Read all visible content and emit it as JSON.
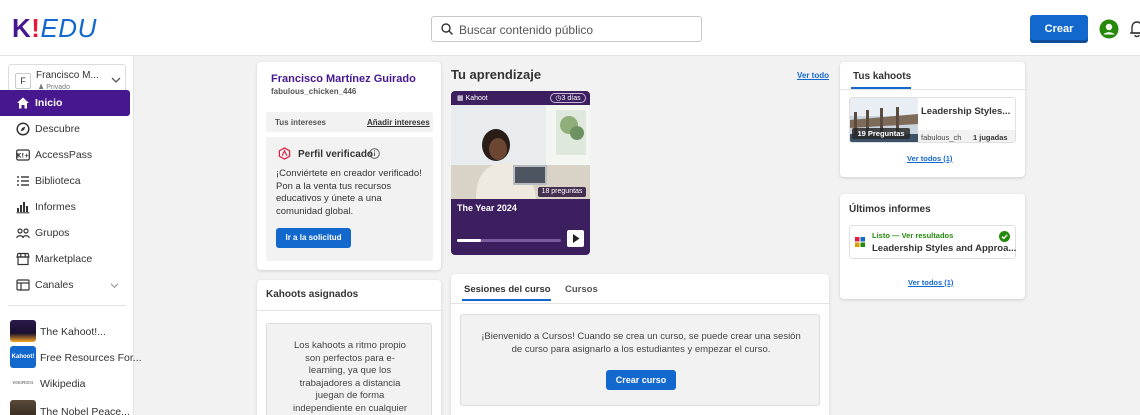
{
  "header": {
    "logo_k": "K",
    "logo_bang": "!",
    "logo_edu": "EDU",
    "search_placeholder": "Buscar contenido público",
    "create_label": "Crear"
  },
  "sidebar": {
    "account": {
      "initial": "F",
      "name": "Francisco M...",
      "privacy": "Privado"
    },
    "items": [
      {
        "label": "Inicio",
        "icon": "home-icon",
        "active": true
      },
      {
        "label": "Descubre",
        "icon": "compass-icon"
      },
      {
        "label": "AccessPass",
        "icon": "accesspass-icon"
      },
      {
        "label": "Biblioteca",
        "icon": "list-icon"
      },
      {
        "label": "Informes",
        "icon": "chart-icon"
      },
      {
        "label": "Grupos",
        "icon": "group-icon"
      },
      {
        "label": "Marketplace",
        "icon": "store-icon"
      },
      {
        "label": "Canales",
        "icon": "channel-icon"
      }
    ],
    "channels": [
      {
        "label": "The Kahoot!...",
        "thumb": ""
      },
      {
        "label": "Free Resources For...",
        "thumb": "Kahoot!"
      },
      {
        "label": "Wikipedia",
        "thumb": "WIKIPEDIA"
      },
      {
        "label": "The Nobel Peace...",
        "thumb": ""
      }
    ]
  },
  "profile": {
    "name": "Francisco Martínez Guirado",
    "username": "fabulous_chicken_446",
    "interests_label": "Tus intereses",
    "add_interests": "Añadir intereses",
    "verified_title": "Perfil verificado",
    "verified_desc": "¡Conviértete en creador verificado! Pon a la venta tus recursos educativos y únete a una comunidad global.",
    "apply_button": "Ir a la solicitud"
  },
  "assigned": {
    "title": "Kahoots asignados",
    "text": "Los kahoots a ritmo propio son perfectos para e-learning, ya que los trabajadores a distancia juegan de forma independiente en cualquier"
  },
  "learning": {
    "title": "Tu aprendizaje",
    "view_all": "Ver todo",
    "card": {
      "brand": "Kahoot",
      "days": "3 días",
      "questions": "18 preguntas",
      "title": "The Year 2024",
      "progress": 0.23
    }
  },
  "courses": {
    "tab_sessions": "Sesiones del curso",
    "tab_courses": "Cursos",
    "text": "¡Bienvenido a Cursos! Cuando se crea un curso, se puede crear una sesión de curso para asignarlo a los estudiantes y empezar el curso.",
    "create_button": "Crear curso"
  },
  "my_kahoots": {
    "title": "Tus kahoots",
    "item": {
      "title": "Leadership Styles...",
      "questions": "19 Preguntas",
      "user": "fabulous_ch",
      "plays": "1 jugadas"
    },
    "view_all": "Ver todos (1)"
  },
  "reports": {
    "title": "Últimos informes",
    "item": {
      "status": "Listo — Ver resultados",
      "title": "Leadership Styles and Approa..."
    },
    "view_all": "Ver todos (1)"
  },
  "colors": {
    "brand_purple": "#46178f",
    "primary_blue": "#1368ce",
    "success_green": "#26890c"
  }
}
